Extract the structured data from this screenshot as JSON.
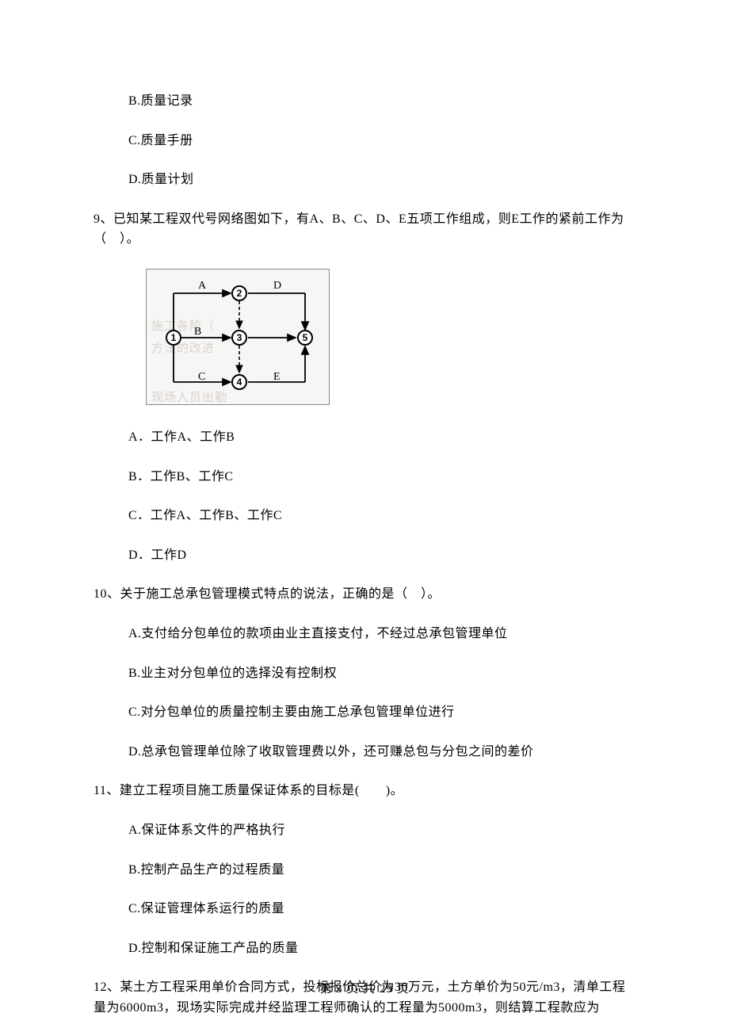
{
  "q8_spill": {
    "optB": "B.质量记录",
    "optC": "C.质量手册",
    "optD": "D.质量计划"
  },
  "q9": {
    "stem": "9、已知某工程双代号网络图如下，有A、B、C、D、E五项工作组成，则E工作的紧前工作为（　）。",
    "optA": "A．工作A、工作B",
    "optB": "B．工作B、工作C",
    "optC": "C．工作A、工作B、工作C",
    "optD": "D．工作D"
  },
  "diagram": {
    "nodes": {
      "n1": "1",
      "n2": "2",
      "n3": "3",
      "n4": "4",
      "n5": "5"
    },
    "edges": {
      "A": "A",
      "B": "B",
      "C": "C",
      "D": "D",
      "E": "E"
    },
    "bgtext": {
      "l1": "施工各阶（",
      "l2": "方法的改进",
      "l3": "现场人员出勤"
    }
  },
  "q10": {
    "stem": "10、关于施工总承包管理模式特点的说法，正确的是（　）。",
    "optA": "A.支付给分包单位的款项由业主直接支付，不经过总承包管理单位",
    "optB": "B.业主对分包单位的选择没有控制权",
    "optC": "C.对分包单位的质量控制主要由施工总承包管理单位进行",
    "optD": "D.总承包管理单位除了收取管理费以外，还可赚总包与分包之间的差价"
  },
  "q11": {
    "stem": "11、建立工程项目施工质量保证体系的目标是(　　)。",
    "optA": "A.保证体系文件的严格执行",
    "optB": "B.控制产品生产的过程质量",
    "optC": "C.保证管理体系运行的质量",
    "optD": "D.控制和保证施工产品的质量"
  },
  "q12": {
    "stem": "12、某土方工程采用单价合同方式，投标报价总价为30万元，土方单价为50元/m3，清单工程量为6000m3，现场实际完成并经监理工程师确认的工程量为5000m3，则结算工程款应为"
  },
  "footer": "第 3 页 共 29 页"
}
